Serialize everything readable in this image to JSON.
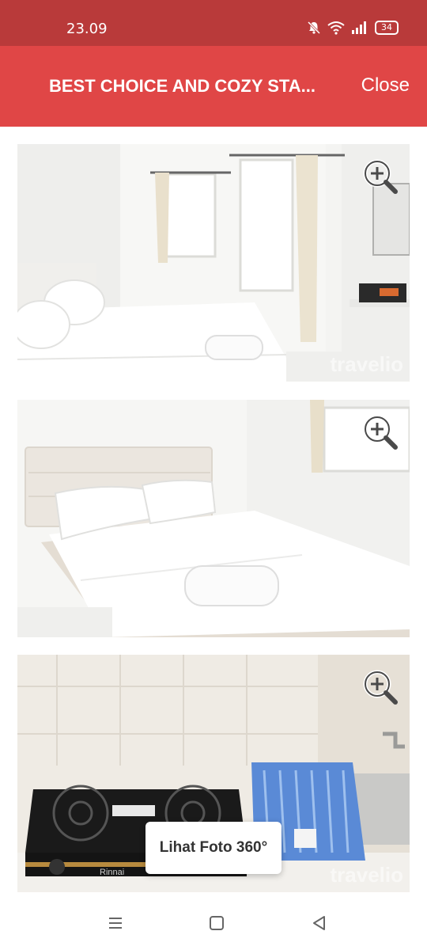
{
  "status": {
    "time": "23.09",
    "battery": "34",
    "icons": [
      "mute-bell-icon",
      "wifi-icon",
      "signal-icon",
      "battery-icon"
    ]
  },
  "header": {
    "title": "BEST CHOICE AND COZY STA...",
    "close_label": "Close"
  },
  "photos": [
    {
      "name": "bedroom-window",
      "watermark": "travelio",
      "zoom_icon": "zoom-in-icon"
    },
    {
      "name": "bed-towel",
      "watermark": "travelio",
      "zoom_icon": "zoom-in-icon"
    },
    {
      "name": "kitchen-stove",
      "watermark": "travelio",
      "zoom_icon": "zoom-in-icon",
      "stove_brand": "Rinnai"
    }
  ],
  "button_360": "Lihat Foto 360°",
  "navbar": {
    "icons": [
      "menu-icon",
      "home-icon",
      "back-icon"
    ]
  },
  "colors": {
    "statusbar": "#b93a3a",
    "appbar": "#e04646"
  }
}
